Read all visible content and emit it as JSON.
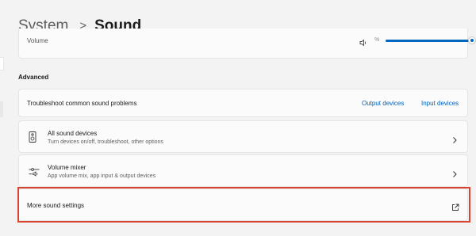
{
  "breadcrumb": {
    "parent": "System",
    "separator": ">",
    "current": "Sound"
  },
  "volume": {
    "label": "Volume",
    "value_text": "%",
    "level": 0.97
  },
  "advanced": {
    "heading": "Advanced",
    "troubleshoot": {
      "label": "Troubleshoot common sound problems",
      "output_link": "Output devices",
      "input_link": "Input devices"
    },
    "all_devices": {
      "title": "All sound devices",
      "subtitle": "Turn devices on/off, troubleshoot, other options",
      "icon": "speaker-device-icon"
    },
    "mixer": {
      "title": "Volume mixer",
      "subtitle": "App volume mix, app input & output devices",
      "icon": "volume-mixer-icon"
    },
    "more": {
      "label": "More sound settings",
      "icon": "open-external-icon"
    }
  },
  "colors": {
    "accent": "#0067c0",
    "link": "#005fb8",
    "highlight": "#d9432f"
  }
}
